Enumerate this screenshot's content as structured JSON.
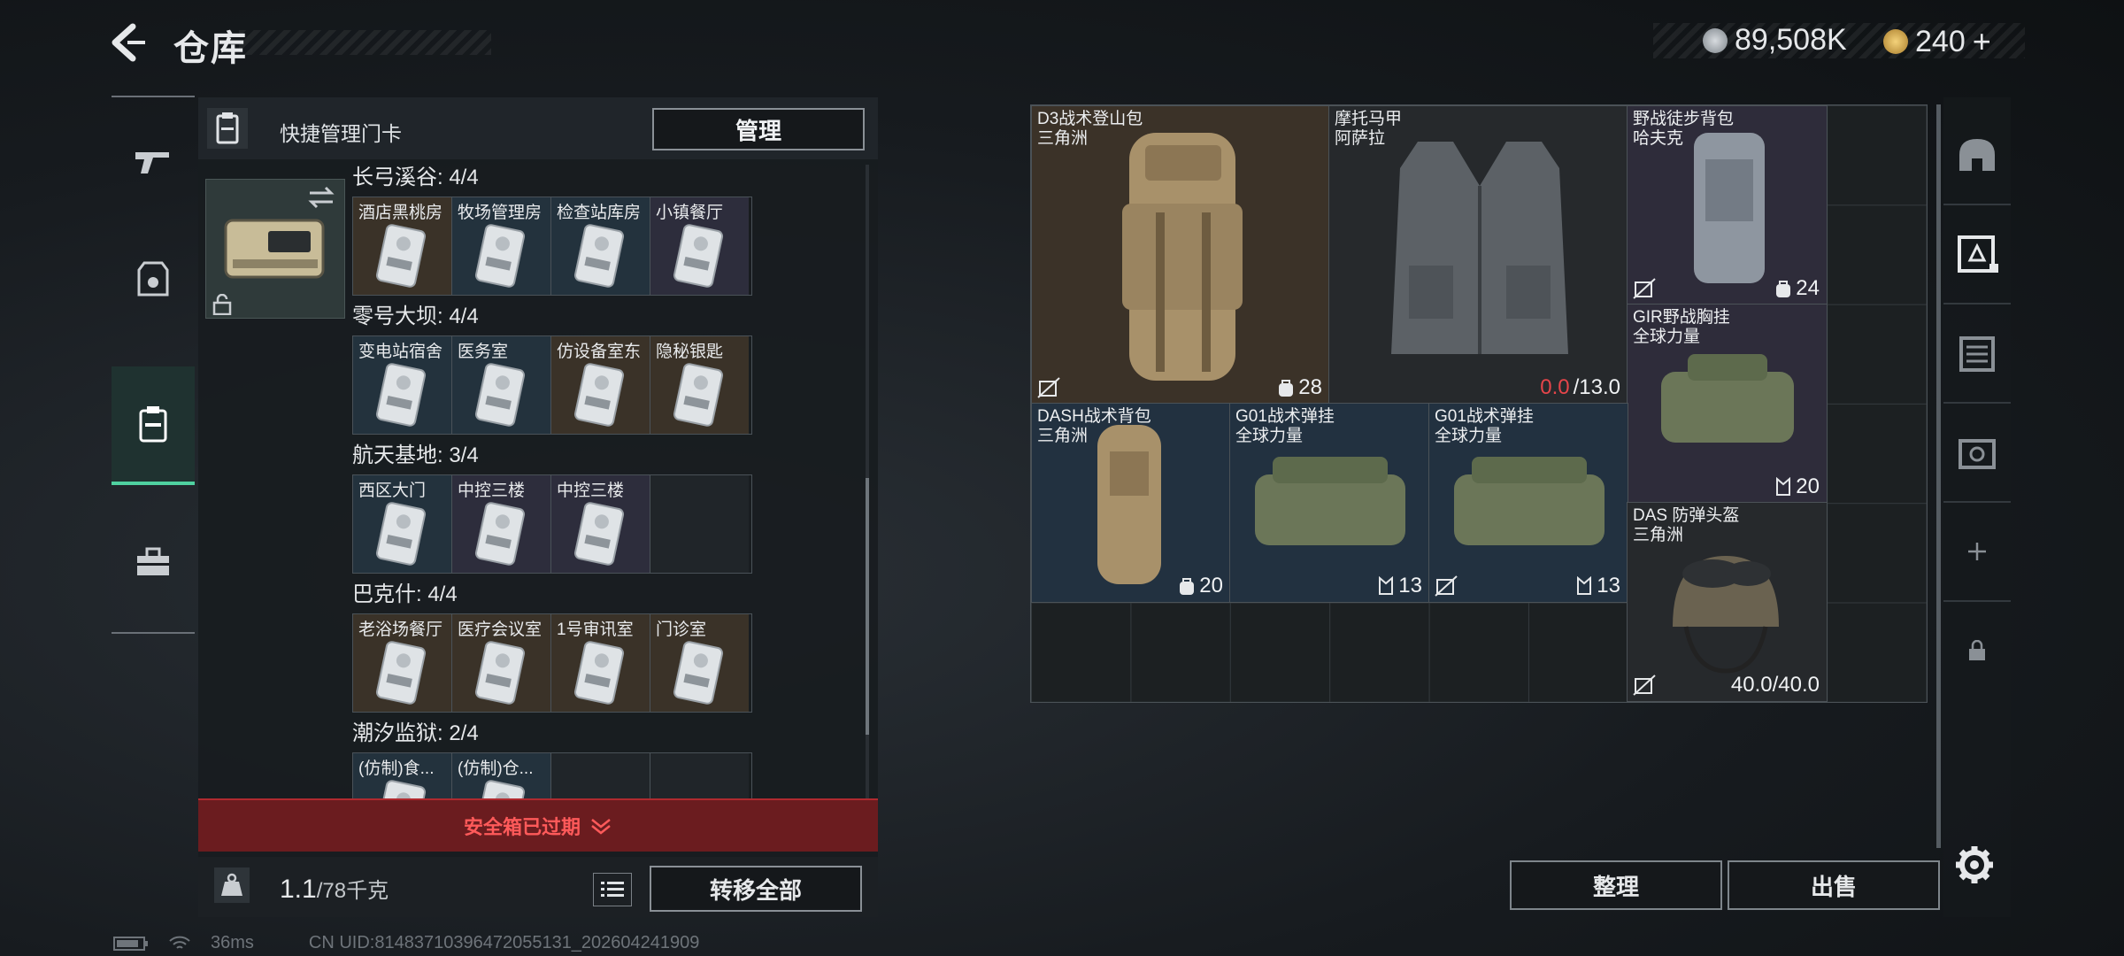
{
  "header": {
    "title": "仓库",
    "currency": [
      {
        "icon": "silver-coin-icon",
        "value": "89,508K"
      },
      {
        "icon": "gold-coin-icon",
        "value": "240"
      }
    ],
    "add_symbol": "+"
  },
  "left_nav": {
    "items": [
      {
        "icon": "gun-icon"
      },
      {
        "icon": "armor-icon"
      },
      {
        "icon": "keycard-icon",
        "active": true
      },
      {
        "icon": "toolbox-icon"
      }
    ]
  },
  "card_panel": {
    "title": "快捷管理门卡",
    "manage_label": "管理",
    "groups": [
      {
        "label": "长弓溪谷: 4/4",
        "slots": [
          {
            "name": "酒店黑桃房",
            "color": "brown"
          },
          {
            "name": "牧场管理房",
            "color": "blue"
          },
          {
            "name": "检查站库房",
            "color": "blue"
          },
          {
            "name": "小镇餐厅",
            "color": "purple"
          }
        ]
      },
      {
        "label": "零号大坝: 4/4",
        "slots": [
          {
            "name": "变电站宿舍",
            "color": "blue"
          },
          {
            "name": "医务室",
            "color": "blue"
          },
          {
            "name": "仿设备室东",
            "color": "brown"
          },
          {
            "name": "隐秘银匙",
            "color": "brown"
          }
        ]
      },
      {
        "label": "航天基地: 3/4",
        "slots": [
          {
            "name": "西区大门",
            "color": "blue"
          },
          {
            "name": "中控三楼",
            "color": "purple"
          },
          {
            "name": "中控三楼",
            "color": "purple"
          },
          {
            "name": "",
            "color": "empty"
          }
        ]
      },
      {
        "label": "巴克什: 4/4",
        "slots": [
          {
            "name": "老浴场餐厅",
            "color": "brown"
          },
          {
            "name": "医疗会议室",
            "color": "brown"
          },
          {
            "name": "1号审讯室",
            "color": "brown"
          },
          {
            "name": "门诊室",
            "color": "brown"
          }
        ]
      },
      {
        "label": "潮汐监狱: 2/4",
        "slots": [
          {
            "name": "(仿制)食...",
            "color": "blue"
          },
          {
            "name": "(仿制)仓...",
            "color": "blue"
          },
          {
            "name": "",
            "color": "empty"
          },
          {
            "name": "",
            "color": "empty"
          }
        ]
      }
    ],
    "expired_text": "安全箱已过期",
    "weight_current": "1.1",
    "weight_max": "/78千克",
    "transfer_label": "转移全部"
  },
  "stash": {
    "items": [
      {
        "name": "D3战术登山包\n三角洲",
        "stat": "28",
        "stat_icon": "backpack-capacity-icon",
        "nosell": true
      },
      {
        "name": "摩托马甲\n阿萨拉",
        "stat_red": "0.0",
        "stat": "/13.0"
      },
      {
        "name": "野战徒步背包\n哈夫克",
        "stat": "24",
        "stat_icon": "backpack-capacity-icon",
        "nosell": true
      },
      {
        "name": "GIR野战胸挂\n全球力量",
        "stat": "20",
        "stat_icon": "rig-capacity-icon"
      },
      {
        "name": "DASH战术背包\n三角洲",
        "stat": "20",
        "stat_icon": "backpack-capacity-icon"
      },
      {
        "name": "G01战术弹挂\n全球力量",
        "stat": "13",
        "stat_icon": "rig-capacity-icon"
      },
      {
        "name": "G01战术弹挂\n全球力量",
        "stat": "13",
        "stat_icon": "rig-capacity-icon",
        "nosell": true
      },
      {
        "name": "DAS 防弹头盔\n三角洲",
        "stat": "40.0/40.0",
        "nosell": true
      }
    ],
    "sort_label": "整理",
    "sell_label": "出售"
  },
  "right_bar": {
    "icons": [
      "helmet-slot-icon",
      "chest-rig-slot-icon",
      "backpack-slot-icon",
      "pouch-slot-icon",
      "add-icon",
      "lock-icon"
    ]
  },
  "status_bar": {
    "ping": "36ms",
    "uid": "CN UID:81483710396472055131_202604241909"
  },
  "colors": {
    "accent": "#4fd1a0",
    "alert_red": "#e5454a"
  }
}
